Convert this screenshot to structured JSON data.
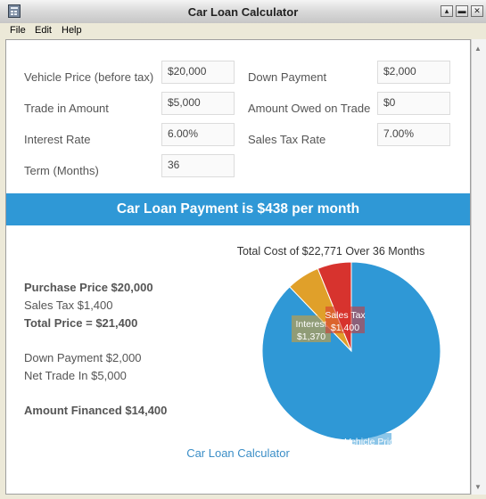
{
  "window": {
    "title": "Car Loan Calculator"
  },
  "menu": [
    "File",
    "Edit",
    "Help"
  ],
  "form": {
    "vehicle_price": {
      "label": "Vehicle Price (before tax)",
      "value": "$20,000"
    },
    "down_payment": {
      "label": "Down Payment",
      "value": "$2,000"
    },
    "trade_in": {
      "label": "Trade in Amount",
      "value": "$5,000"
    },
    "owed_on_trade": {
      "label": "Amount Owed on Trade",
      "value": "$0"
    },
    "interest_rate": {
      "label": "Interest Rate",
      "value": "6.00%"
    },
    "sales_tax_rate": {
      "label": "Sales Tax Rate",
      "value": "7.00%"
    },
    "term": {
      "label": "Term (Months)",
      "value": "36"
    }
  },
  "banner": "Car Loan Payment is $438 per month",
  "summary": {
    "purchase_price": "Purchase Price $20,000",
    "sales_tax": "Sales Tax $1,400",
    "total_price": "Total Price = $21,400",
    "down_payment": "Down Payment $2,000",
    "net_trade_in": "Net Trade In $5,000",
    "amount_financed": "Amount Financed $14,400"
  },
  "chart": {
    "title": "Total Cost of $22,771 Over 36 Months",
    "slices": [
      {
        "label": "Vehicle Price",
        "value_label": "$20,000",
        "value": 20000,
        "color": "#2f98d6"
      },
      {
        "label": "Interest",
        "value_label": "$1,370",
        "value": 1371,
        "color": "#e0a02a"
      },
      {
        "label": "Sales Tax",
        "value_label": "$1,400",
        "value": 1400,
        "color": "#d7332e"
      }
    ]
  },
  "footer_link": "Car Loan Calculator"
}
